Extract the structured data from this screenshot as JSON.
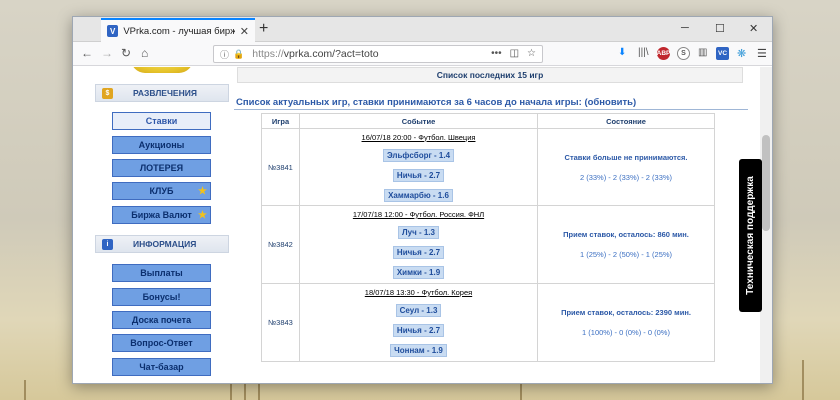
{
  "browser": {
    "tab_title": "VPrka.com - лучшая биржа о",
    "favicon_label": "V",
    "url_prefix": "https://",
    "url": "vprka.com/?act=toto",
    "toolbar_icons": [
      "downloads-icon",
      "library-icon",
      "adblock-icon",
      "s-ext-icon",
      "sidebar-icon",
      "vc-icon",
      "gear-ext-icon",
      "menu-icon"
    ],
    "adblock_label": "ABP",
    "vc_label": "VC"
  },
  "sidebar": {
    "sections": [
      {
        "title": "РАЗВЛЕЧЕНИЯ",
        "icon": "coins-icon",
        "items": [
          {
            "label": "Ставки",
            "active": true,
            "star": false
          },
          {
            "label": "Аукционы",
            "active": false,
            "star": false
          },
          {
            "label": "ЛОТЕРЕЯ",
            "active": false,
            "star": false
          },
          {
            "label": "КЛУБ",
            "active": false,
            "star": true
          },
          {
            "label": "Биржа Валют",
            "active": false,
            "star": true
          }
        ]
      },
      {
        "title": "ИНФОРМАЦИЯ",
        "icon": "info-icon",
        "items": [
          {
            "label": "Выплаты",
            "active": false,
            "star": false
          },
          {
            "label": "Бонусы!",
            "active": false,
            "star": false
          },
          {
            "label": "Доска почета",
            "active": false,
            "star": false
          },
          {
            "label": "Вопрос-Ответ",
            "active": false,
            "star": false
          },
          {
            "label": "Чат-базар",
            "active": false,
            "star": false
          }
        ]
      }
    ]
  },
  "main": {
    "last_games_title": "Список последних 15 игр",
    "actual_games_title": "Список актуальных игр, ставки принимаются за 6 часов до начала игры:",
    "refresh_link": "(обновить)",
    "table": {
      "headers": [
        "Игра",
        "Событие",
        "Состояние"
      ],
      "rows": [
        {
          "game": "№3841",
          "event": "16/07/18 20:00 - Футбол. Швеция",
          "options": [
            "Эльфсборг - 1.4",
            "Ничья - 2.7",
            "Хаммарбю - 1.6"
          ],
          "status": "Ставки больше не принимаются.",
          "stats": "2 (33%) - 2 (33%) - 2 (33%)"
        },
        {
          "game": "№3842",
          "event": "17/07/18 12:00 - Футбол. Россия. ФНЛ",
          "options": [
            "Луч - 1.3",
            "Ничья - 2.7",
            "Химки - 1.9"
          ],
          "status": "Прием ставок, осталось: 860 мин.",
          "stats": "1 (25%) - 2 (50%) - 1 (25%)"
        },
        {
          "game": "№3843",
          "event": "18/07/18 13:30 - Футбол. Корея",
          "options": [
            "Сеул - 1.3",
            "Ничья - 2.7",
            "Чоннам - 1.9"
          ],
          "status": "Прием ставок, осталось: 2390 мин.",
          "stats": "1 (100%) - 0 (0%) - 0 (0%)"
        }
      ]
    }
  },
  "support_tab": "Техническая поддержка",
  "colors": {
    "accent_tab": "#0a84ff",
    "menu_button": "#6f9fe3",
    "link_blue": "#2c59a7",
    "option_bg": "#c9dcf2"
  }
}
